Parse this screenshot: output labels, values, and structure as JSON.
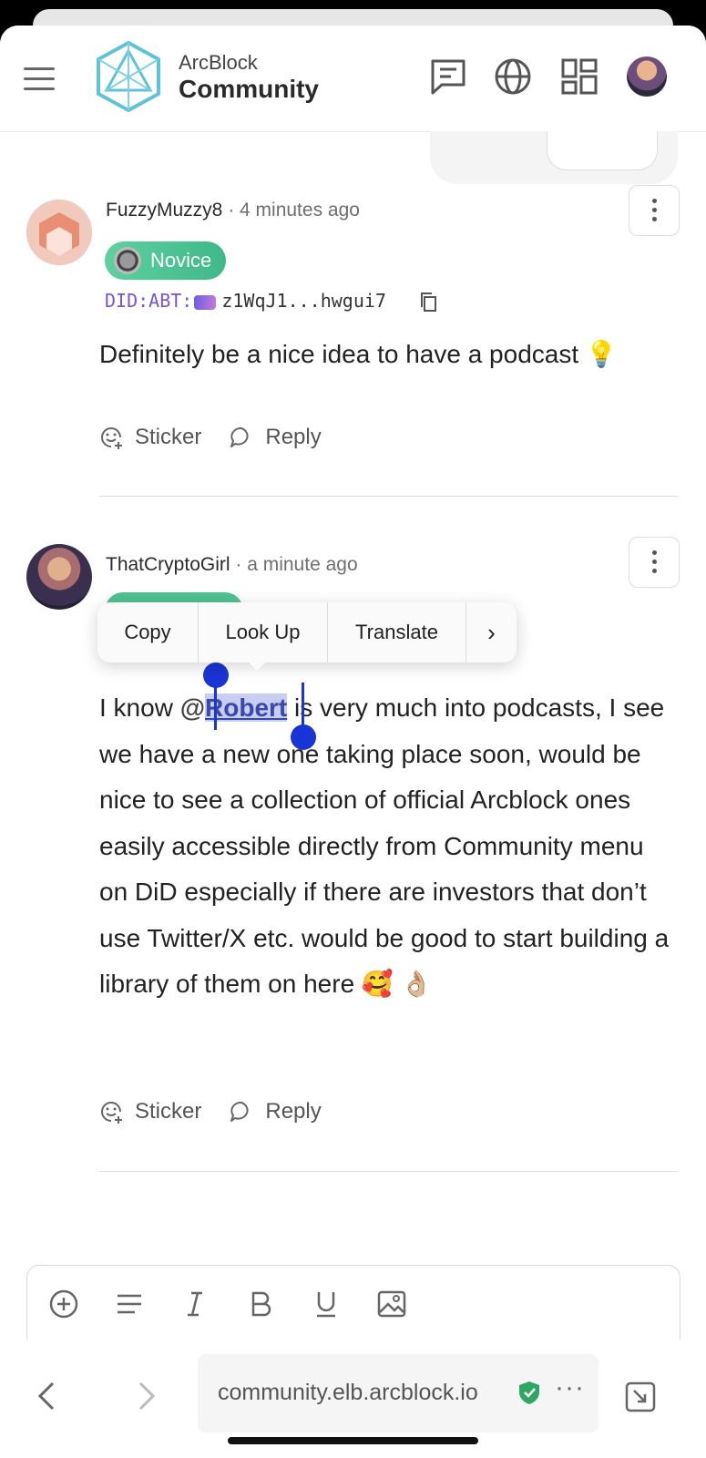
{
  "header": {
    "brand_top": "ArcBlock",
    "brand_bottom": "Community"
  },
  "comments": [
    {
      "author": "FuzzyMuzzy8",
      "time": "· 4 minutes ago",
      "badge": "Novice",
      "did_prefix": "DID:ABT:",
      "did_value": "z1WqJ1...hwgui7",
      "text": "Definitely be a nice idea to have a podcast 💡",
      "sticker_label": "Sticker",
      "reply_label": "Reply"
    },
    {
      "author": "ThatCryptoGirl",
      "time": "· a minute ago",
      "text_before": "I know ",
      "mention_at": "@",
      "mention_name": "Robert",
      "text_after": " is very much into podcasts, I see we have a new one taking place soon, would be nice to see a collection of official Arcblock ones easily accessible directly from Community menu on DiD especially if there are investors that don’t use Twitter/X etc. would be good to start building a library of them on here 🥰 👌🏼",
      "sticker_label": "Sticker",
      "reply_label": "Reply"
    }
  ],
  "context_menu": {
    "copy": "Copy",
    "look_up": "Look Up",
    "translate": "Translate",
    "more": "›"
  },
  "browser": {
    "url": "community.elb.arcblock.io",
    "menu": "···"
  },
  "colors": {
    "badge": "#4fc293",
    "selection": "#1a35d6",
    "did_prefix": "#7a55c8"
  }
}
